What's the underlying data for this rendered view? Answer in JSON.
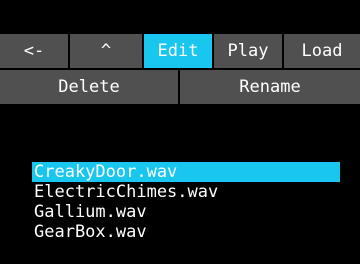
{
  "toolbar": {
    "back_label": "<-",
    "up_label": "^",
    "edit_label": "Edit",
    "play_label": "Play",
    "load_label": "Load",
    "active_tab": "Edit"
  },
  "actions": {
    "delete_label": "Delete",
    "rename_label": "Rename"
  },
  "files": [
    {
      "name": "CreakyDoor.wav",
      "selected": true
    },
    {
      "name": "ElectricChimes.wav",
      "selected": false
    },
    {
      "name": "Gallium.wav",
      "selected": false
    },
    {
      "name": "GearBox.wav",
      "selected": false
    }
  ],
  "colors": {
    "accent": "#19c6ee",
    "button_bg": "#505050",
    "background": "#000000",
    "text": "#ffffff"
  }
}
